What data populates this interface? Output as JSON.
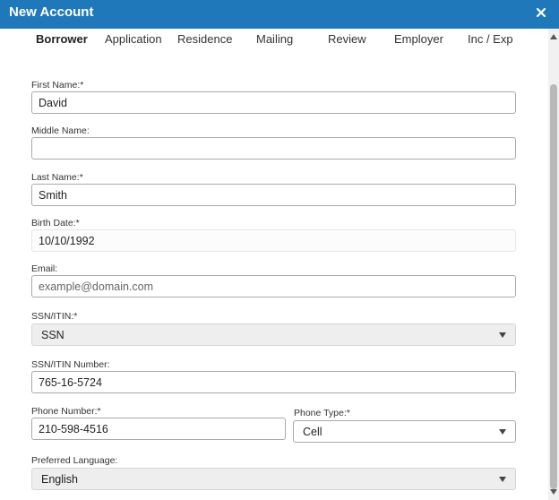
{
  "window": {
    "title": "New Account",
    "close_icon": "close-icon"
  },
  "tabs": [
    {
      "label": "Borrower",
      "active": true
    },
    {
      "label": "Application"
    },
    {
      "label": "Residence"
    },
    {
      "label": "Mailing"
    },
    {
      "label": "Review"
    },
    {
      "label": "Employer"
    },
    {
      "label": "Inc / Exp"
    }
  ],
  "form": {
    "first_name": {
      "label": "First Name:*",
      "value": "David"
    },
    "middle_name": {
      "label": "Middle Name:",
      "value": ""
    },
    "last_name": {
      "label": "Last Name:*",
      "value": "Smith"
    },
    "birth_date": {
      "label": "Birth Date:*",
      "value": "10/10/1992"
    },
    "email": {
      "label": "Email:",
      "placeholder": "example@domain.com",
      "value": ""
    },
    "ssn_itin": {
      "label": "SSN/ITIN:*",
      "selected": "SSN"
    },
    "ssn_itin_number": {
      "label": "SSN/ITIN Number:",
      "value": "765-16-5724"
    },
    "phone_number": {
      "label": "Phone Number:*",
      "value": "210-598-4516"
    },
    "phone_type": {
      "label": "Phone Type:*",
      "selected": "Cell"
    },
    "preferred_language": {
      "label": "Preferred Language:",
      "selected": "English"
    }
  },
  "colors": {
    "titlebar": "#1f78b9",
    "field_border": "#a9a9a9",
    "select_bg": "#eeeeee"
  }
}
